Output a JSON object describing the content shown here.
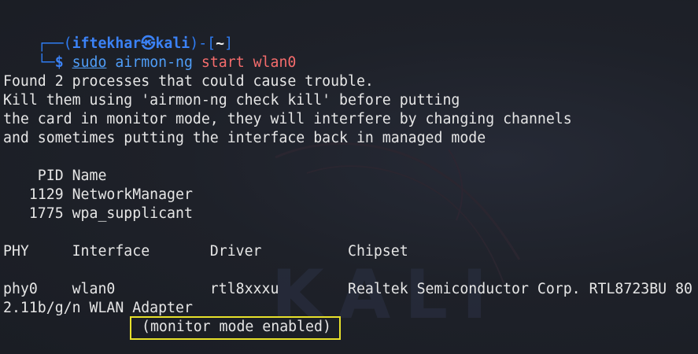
{
  "prompt": {
    "corner_top": "┌──(",
    "user": "iftekhar",
    "at_symbol": "㉿",
    "host": "kali",
    "mid": ")-[",
    "path": "~",
    "close": "]",
    "corner_bottom": "└─",
    "dollar": "$"
  },
  "command": {
    "sudo": "sudo",
    "program": "airmon-ng",
    "args": "start wlan0"
  },
  "output": {
    "warning_lines": [
      "Found 2 processes that could cause trouble.",
      "Kill them using 'airmon-ng check kill' before putting",
      "the card in monitor mode, they will interfere by changing channels",
      "and sometimes putting the interface back in managed mode"
    ],
    "process_header": "    PID Name",
    "processes": [
      "   1129 NetworkManager",
      "   1775 wpa_supplicant"
    ],
    "iface_header": "PHY     Interface       Driver          Chipset",
    "iface_row": "phy0    wlan0           rtl8xxxu        Realtek Semiconductor Corp. RTL8723BU 80",
    "iface_wrap": "2.11b/g/n WLAN Adapter",
    "monitor_status": "(monitor mode enabled)"
  },
  "watermark": {
    "text": "KALI"
  },
  "colors": {
    "background": "#1c1f27",
    "prompt_blue": "#2f7cf2",
    "command_blue": "#4f9df7",
    "argument_red": "#f56c6c",
    "highlight_yellow": "#e8e12b"
  }
}
